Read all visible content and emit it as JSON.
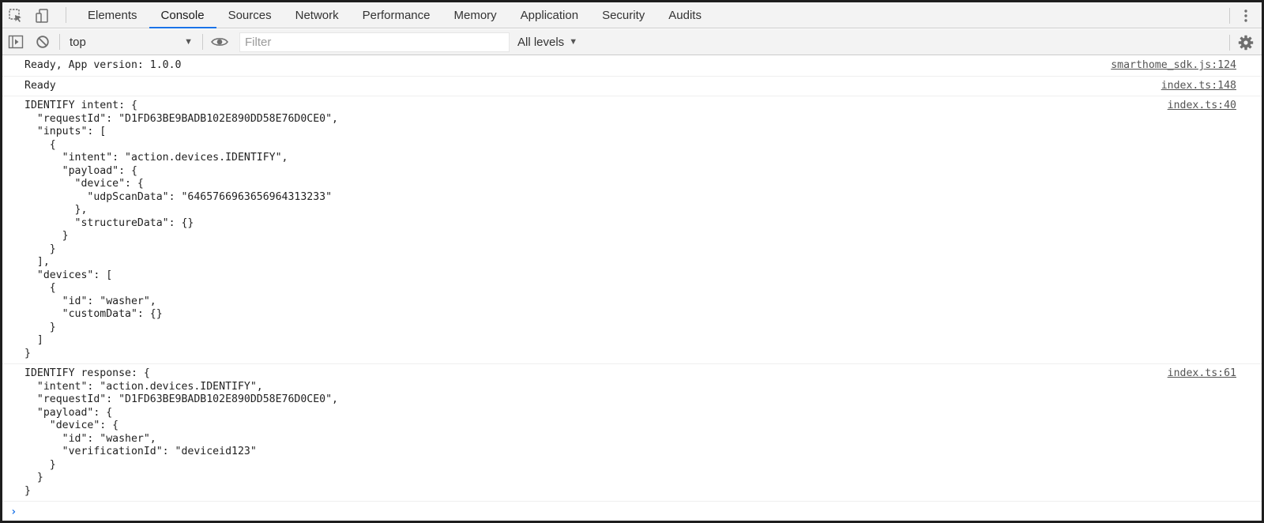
{
  "tabbar": {
    "tabs": [
      {
        "label": "Elements"
      },
      {
        "label": "Console"
      },
      {
        "label": "Sources"
      },
      {
        "label": "Network"
      },
      {
        "label": "Performance"
      },
      {
        "label": "Memory"
      },
      {
        "label": "Application"
      },
      {
        "label": "Security"
      },
      {
        "label": "Audits"
      }
    ],
    "active_tab": "Console",
    "icons": [
      "inspect-element-icon",
      "device-toolbar-icon",
      "more-menu-icon"
    ]
  },
  "toolbar": {
    "context": "top",
    "filter_placeholder": "Filter",
    "filter_value": "",
    "levels_label": "All levels",
    "icons": [
      "sidebar-toggle-icon",
      "clear-console-icon",
      "eye-icon",
      "gear-icon"
    ]
  },
  "messages": [
    {
      "text": "Ready, App version: 1.0.0",
      "source": "smarthome_sdk.js:124"
    },
    {
      "text": "Ready",
      "source": "index.ts:148"
    },
    {
      "text": "IDENTIFY intent: {\n  \"requestId\": \"D1FD63BE9BADB102E890DD58E76D0CE0\",\n  \"inputs\": [\n    {\n      \"intent\": \"action.devices.IDENTIFY\",\n      \"payload\": {\n        \"device\": {\n          \"udpScanData\": \"6465766963656964313233\"\n        },\n        \"structureData\": {}\n      }\n    }\n  ],\n  \"devices\": [\n    {\n      \"id\": \"washer\",\n      \"customData\": {}\n    }\n  ]\n}",
      "source": "index.ts:40"
    },
    {
      "text": "IDENTIFY response: {\n  \"intent\": \"action.devices.IDENTIFY\",\n  \"requestId\": \"D1FD63BE9BADB102E890DD58E76D0CE0\",\n  \"payload\": {\n    \"device\": {\n      \"id\": \"washer\",\n      \"verificationId\": \"deviceid123\"\n    }\n  }\n}",
      "source": "index.ts:61"
    }
  ],
  "colors": {
    "toolbar_bg": "#f3f3f3",
    "active_tab_underline": "#1a73e8",
    "prompt_caret": "#1a73e8"
  }
}
